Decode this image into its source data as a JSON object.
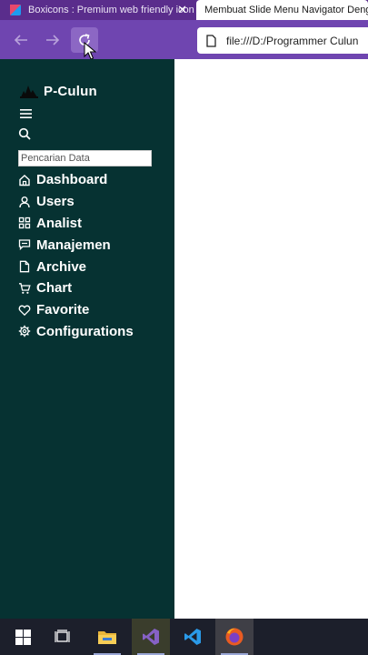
{
  "browser": {
    "tabs": [
      {
        "title": "Boxicons : Premium web friendly icons",
        "active": false
      },
      {
        "title": "Membuat Slide Menu Navigator Dengan",
        "active": true
      }
    ],
    "url": "file:///D:/Programmer Culun"
  },
  "sidebar": {
    "brand": "P-Culun",
    "search_placeholder": "Pencarian Data",
    "items": [
      {
        "label": "Dashboard",
        "icon": "home-icon"
      },
      {
        "label": "Users",
        "icon": "user-icon"
      },
      {
        "label": "Analist",
        "icon": "grid-icon"
      },
      {
        "label": "Manajemen",
        "icon": "chat-icon"
      },
      {
        "label": "Archive",
        "icon": "file-icon"
      },
      {
        "label": "Chart",
        "icon": "cart-icon"
      },
      {
        "label": "Favorite",
        "icon": "heart-icon"
      },
      {
        "label": "Configurations",
        "icon": "cog-icon"
      }
    ]
  },
  "taskbar": {
    "apps": [
      "windows-start",
      "task-view",
      "file-explorer",
      "visual-studio",
      "vs-code",
      "firefox"
    ]
  },
  "colors": {
    "tab_bar": "#5a2d8c",
    "toolbar": "#6f45b0",
    "sidebar_bg": "#063232",
    "taskbar": "#1c1f2b"
  }
}
